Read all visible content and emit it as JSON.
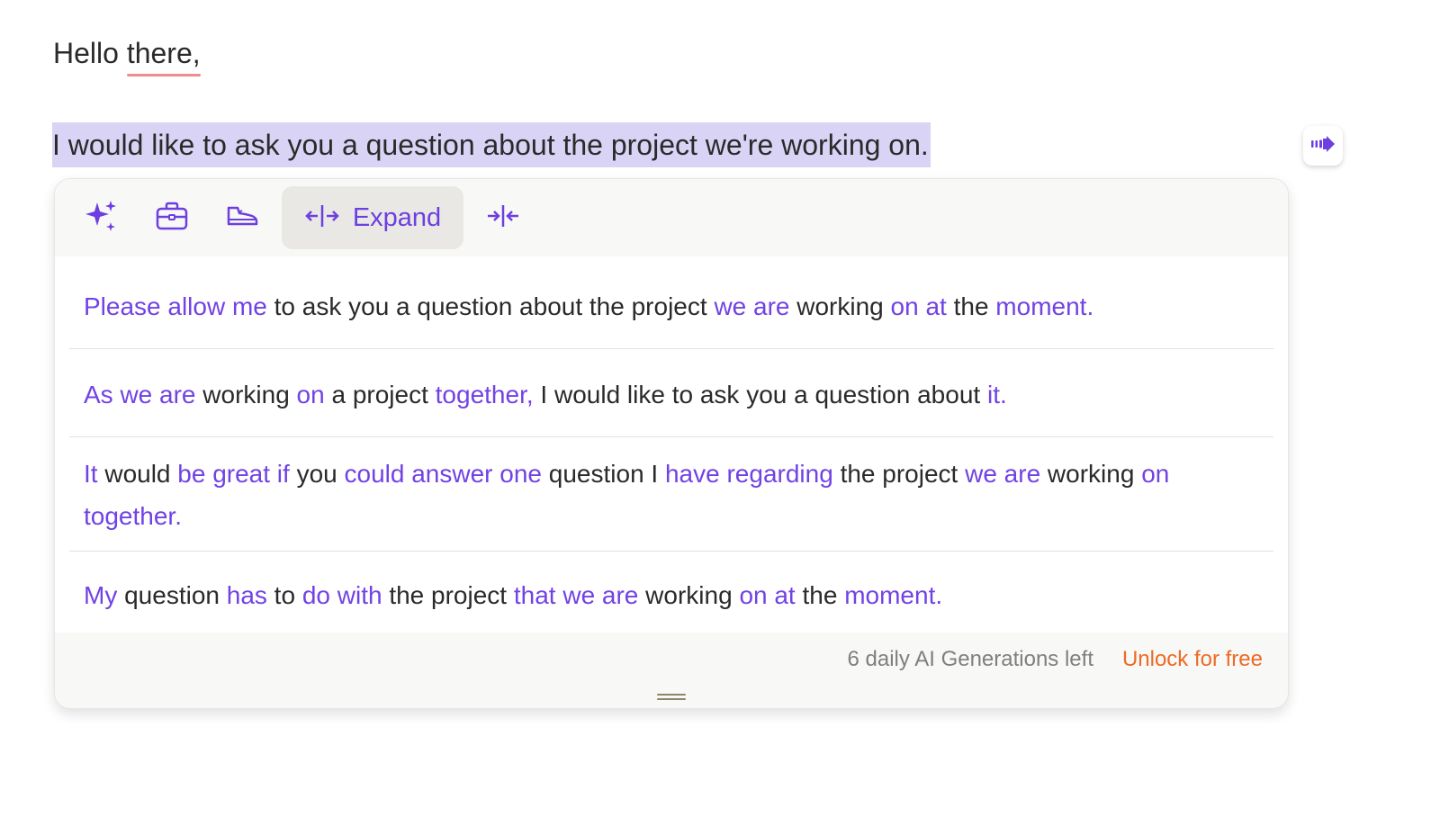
{
  "document": {
    "greeting_first": "Hello ",
    "greeting_word": "there,",
    "selected_sentence": "I would like to ask you a question about the project we're working on."
  },
  "toolbar": {
    "tools": [
      {
        "icon": "sparkles-icon",
        "label": ""
      },
      {
        "icon": "briefcase-icon",
        "label": ""
      },
      {
        "icon": "casual-shoe-icon",
        "label": ""
      },
      {
        "icon": "expand-arrows-icon",
        "label": "Expand"
      },
      {
        "icon": "shorten-arrows-icon",
        "label": ""
      }
    ],
    "active": "Expand"
  },
  "suggestions": [
    {
      "segments": [
        {
          "t": "Please allow me",
          "h": true
        },
        {
          "t": " to ask you a question about the project ",
          "h": false
        },
        {
          "t": "we are",
          "h": true
        },
        {
          "t": " working ",
          "h": false
        },
        {
          "t": "on at",
          "h": true
        },
        {
          "t": " the ",
          "h": false
        },
        {
          "t": "moment.",
          "h": true
        }
      ]
    },
    {
      "segments": [
        {
          "t": "As we are",
          "h": true
        },
        {
          "t": " working ",
          "h": false
        },
        {
          "t": "on",
          "h": true
        },
        {
          "t": " a project ",
          "h": false
        },
        {
          "t": "together,",
          "h": true
        },
        {
          "t": " I would like to ask you a question about ",
          "h": false
        },
        {
          "t": "it.",
          "h": true
        }
      ]
    },
    {
      "segments": [
        {
          "t": "It",
          "h": true
        },
        {
          "t": " would ",
          "h": false
        },
        {
          "t": "be great if",
          "h": true
        },
        {
          "t": " you ",
          "h": false
        },
        {
          "t": "could answer one",
          "h": true
        },
        {
          "t": " question I ",
          "h": false
        },
        {
          "t": "have regarding",
          "h": true
        },
        {
          "t": " the project ",
          "h": false
        },
        {
          "t": "we are",
          "h": true
        },
        {
          "t": " working ",
          "h": false
        },
        {
          "t": "on together.",
          "h": true
        }
      ]
    },
    {
      "segments": [
        {
          "t": "My",
          "h": true
        },
        {
          "t": " question ",
          "h": false
        },
        {
          "t": "has",
          "h": true
        },
        {
          "t": " to ",
          "h": false
        },
        {
          "t": "do with",
          "h": true
        },
        {
          "t": " the project ",
          "h": false
        },
        {
          "t": "that we are",
          "h": true
        },
        {
          "t": " working ",
          "h": false
        },
        {
          "t": "on at",
          "h": true
        },
        {
          "t": " the ",
          "h": false
        },
        {
          "t": "moment.",
          "h": true
        }
      ]
    }
  ],
  "footer": {
    "generations_left": "6 daily AI Generations left",
    "unlock_label": "Unlock for free"
  },
  "colors": {
    "accent": "#6d3fe0",
    "highlight_text": "#7142e4",
    "selection_bg": "#d9d4f6",
    "spelling_underline": "#ef8c8c",
    "unlock": "#ee6a24"
  }
}
